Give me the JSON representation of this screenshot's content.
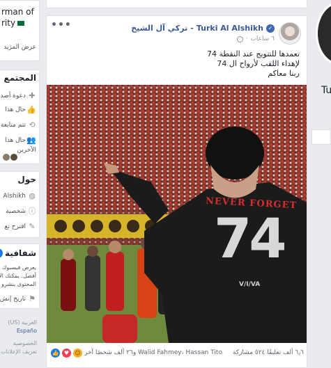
{
  "left_panel": {
    "header_card": {
      "name_line1": "rman of",
      "name_line2": "rity",
      "flag_icon": "saudi-flag-icon",
      "see_more": "عرض المزيد"
    },
    "community": {
      "title": "المجتمع",
      "rows": [
        {
          "icon": "invite-friends-icon",
          "label": "دعوة أصد"
        },
        {
          "icon": "thumbs-up-icon",
          "label": "حال هذا"
        },
        {
          "icon": "follow-icon",
          "label": "تتم متابعة"
        },
        {
          "icon": "friends-icon",
          "label": "حال هذا"
        },
        {
          "icon": "",
          "label": "الآخرين"
        }
      ]
    },
    "about": {
      "title": "حول",
      "rows": [
        {
          "icon": "globe-icon",
          "label": "Alshikh"
        },
        {
          "icon": "info-icon",
          "label": "شخصية"
        },
        {
          "icon": "edit-icon",
          "label": "اقترح تع"
        }
      ]
    },
    "transparency": {
      "title": "شفافية",
      "lines": [
        "يعرض فيسبوك م",
        "أفضل. يمكنك الا",
        "المحتوى ينشرو"
      ],
      "history_label": "تاريخ إنش"
    },
    "footer": {
      "lang_current": "العربية (US)",
      "lang_other": "Españo",
      "links": [
        "الخصوصية",
        "تعريف الإعلانات"
      ]
    }
  },
  "post": {
    "author_ar": "تركي آل الشيخ",
    "author_en": "Turki Al Alshikh",
    "verified": true,
    "time": "٦ ساعات",
    "text_lines": [
      "تعمدها للتتويج عند النقطة 74",
      "لإهداء اللقب لأرواح ال 74",
      "ربنا معاكم"
    ],
    "photo": {
      "shirt_text": "NEVER FORGET",
      "shirt_number": "74",
      "shirt_badge": "V/I/VA"
    },
    "footer": {
      "reaction_icons": [
        "like-icon",
        "love-icon",
        "haha-icon"
      ],
      "reactors": "Walid Fahmey، Hassan Tito و٢٦ ألف شخصًا آخر",
      "comments": "٦٫٦ ألف تعليقًا",
      "shares": "٥٢٤ مشاركة"
    }
  },
  "right_panel": {
    "name_fragment": "Tu"
  },
  "colors": {
    "page_bg": "#e9ebee",
    "link_blue": "#385898",
    "verified_blue": "#4267b2",
    "jersey": "#1b1b1b",
    "crowd_red": "#b22a2a"
  }
}
